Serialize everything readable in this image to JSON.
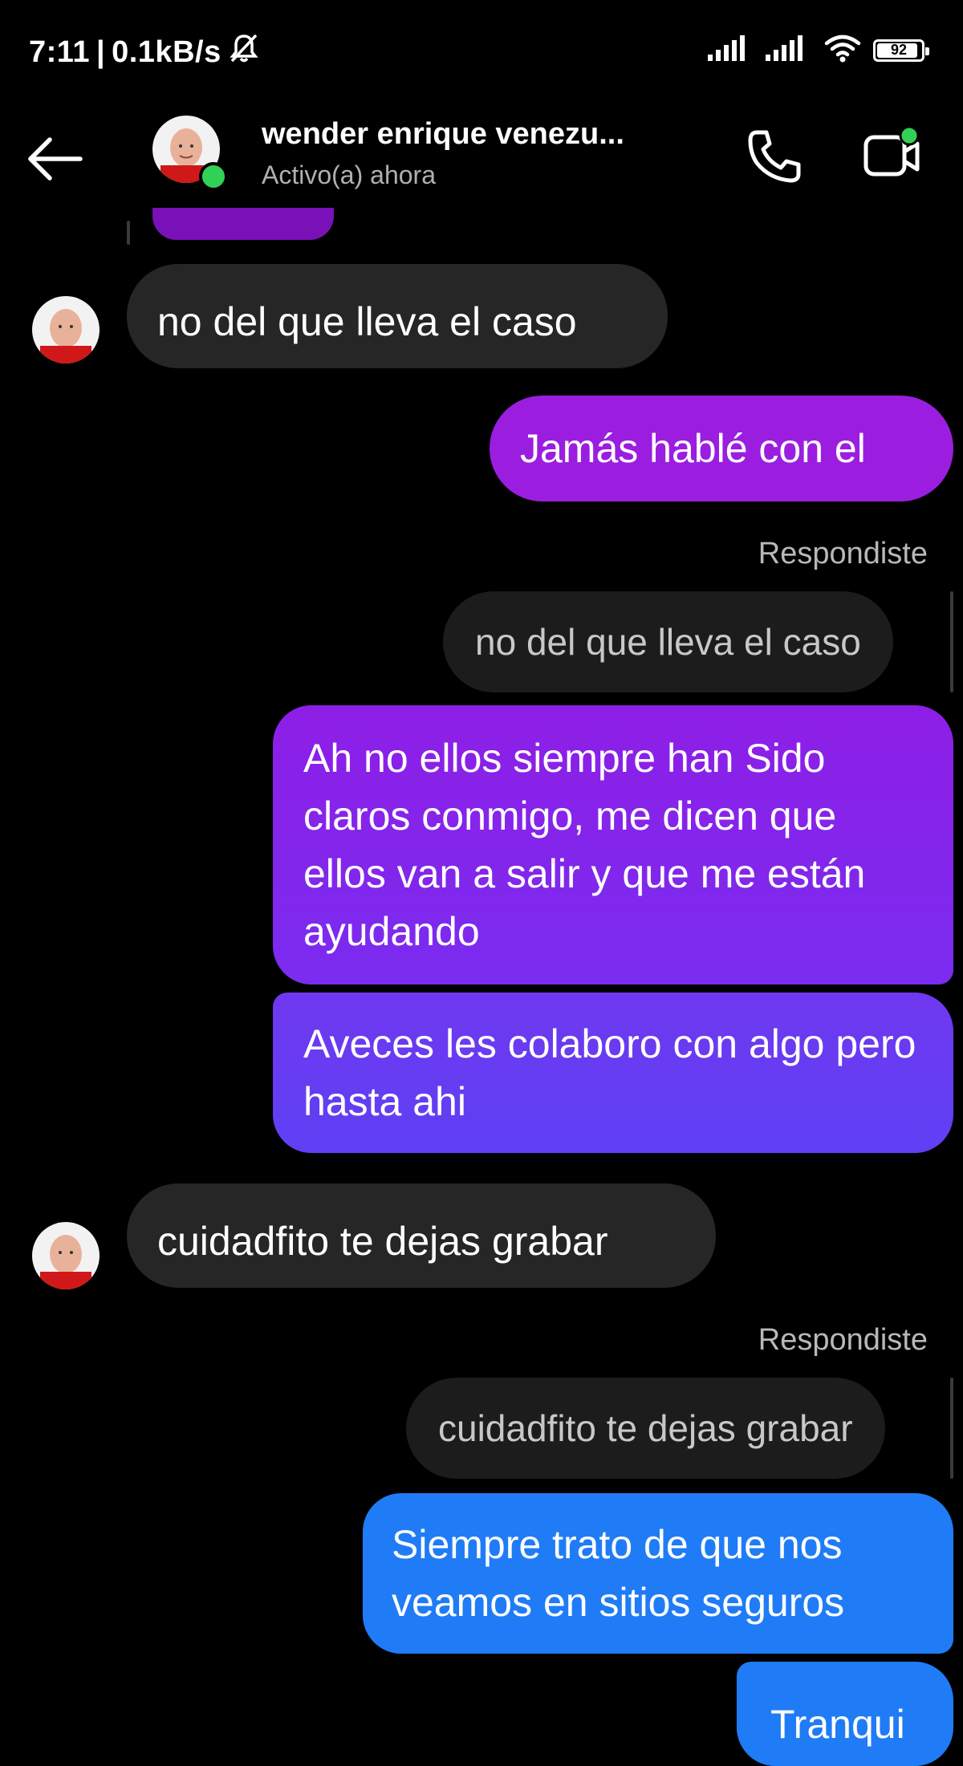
{
  "status_bar": {
    "time": "7:11",
    "network_speed": "0.1kB/s",
    "battery": "92",
    "battery_fraction": 0.92,
    "icons": [
      "mute-bell-icon",
      "signal-icon",
      "signal-icon",
      "wifi-icon",
      "battery-icon"
    ]
  },
  "header": {
    "contact_name": "wender enrique venezu...",
    "contact_status": "Activo(a) ahora",
    "icons": [
      "back-arrow-icon",
      "avatar",
      "phone-icon",
      "video-camera-icon"
    ]
  },
  "messages": {
    "m1": "no del que lleva el caso",
    "m2": "Jamás hablé con el",
    "reply1_label": "Respondiste",
    "reply1_quote": "no del que lleva el caso",
    "m3": "Ah no ellos siempre han Sido claros conmigo, me dicen que ellos van a salir y que me están ayudando",
    "m4": "Aveces les colaboro con algo pero hasta ahi",
    "m5": "cuidadfito te dejas grabar",
    "reply2_label": "Respondiste",
    "reply2_quote": "cuidadfito te dejas grabar",
    "m6": "Siempre trato de que nos veamos en sitios seguros",
    "m7": "Tranqui"
  },
  "colors": {
    "incoming_bubble": "#262626",
    "quote_bubble": "#1c1c1c",
    "outgoing_purple": "#9b1ee0",
    "outgoing_violet": "#6a35f0",
    "outgoing_blue": "#1f7cf6",
    "online": "#31d158"
  }
}
